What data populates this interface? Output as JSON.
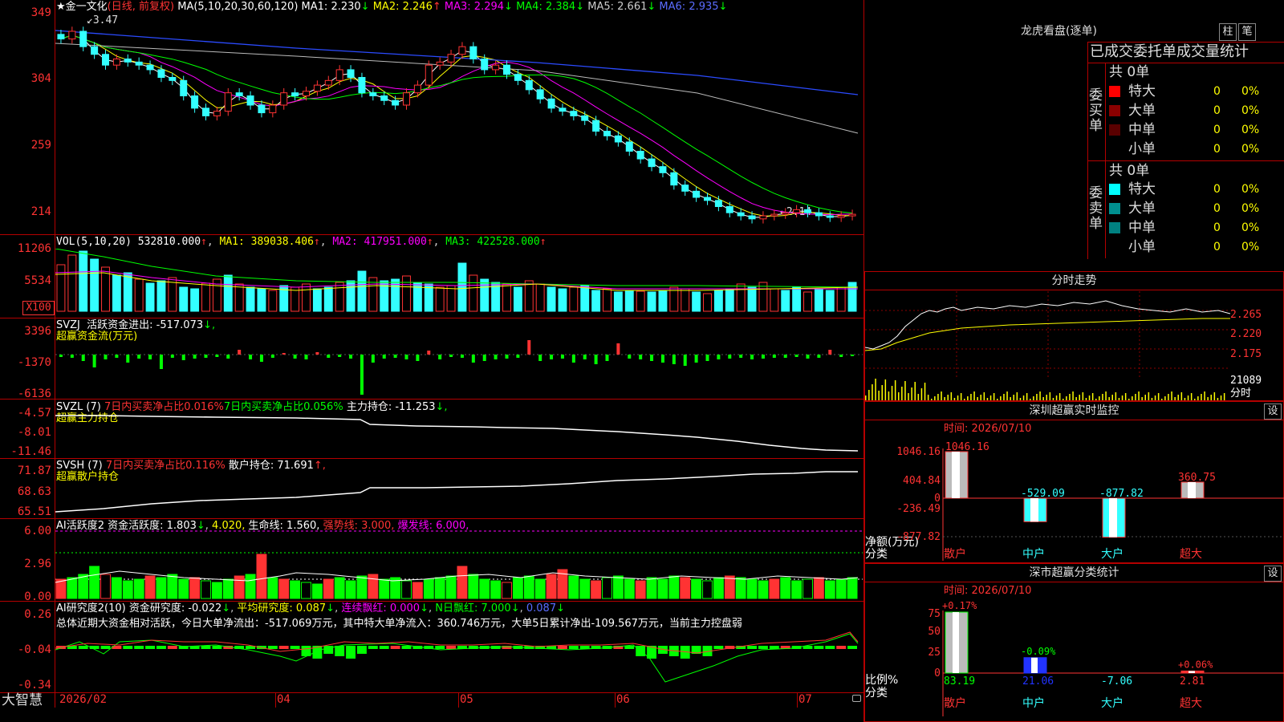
{
  "app": {
    "brand": "大智慧"
  },
  "chart_header": {
    "star": "★",
    "stock_name": "金一文化",
    "period": "(日线, 前复权)",
    "ma_title": "MA(5,10,20,30,60,120)",
    "ma": [
      {
        "label": "MA1:",
        "value": "2.230",
        "arrow": "↓",
        "color": "#ffffff"
      },
      {
        "label": "MA2:",
        "value": "2.246",
        "arrow": "↑",
        "color": "#ffff00"
      },
      {
        "label": "MA3:",
        "value": "2.294",
        "arrow": "↓",
        "color": "#ff00ff"
      },
      {
        "label": "MA4:",
        "value": "2.384",
        "arrow": "↓",
        "color": "#00ff00"
      },
      {
        "label": "MA5:",
        "value": "2.661",
        "arrow": "↓",
        "color": "#cccccc"
      },
      {
        "label": "MA6:",
        "value": "2.935",
        "arrow": "↓",
        "color": "#2b4bff"
      }
    ],
    "high_mark": "3.47",
    "low_mark": "←2.14"
  },
  "price_axis": [
    "349",
    "304",
    "259",
    "214"
  ],
  "vol_panel": {
    "title": "VOL(5,10,20)",
    "value": "532810.000",
    "ma1": "MA1: 389038.406",
    "ma2": "MA2: 417951.000",
    "ma3": "MA3: 422528.000",
    "axis": [
      "11206",
      "5534",
      "X100"
    ]
  },
  "svzj_panel": {
    "title": "SVZJ",
    "line1": "活跃资金进出: -517.073",
    "arrow": "↓,",
    "sub": "超赢资金流(万元)",
    "axis": [
      "3396",
      "-1370",
      "-6136"
    ]
  },
  "svzl_panel": {
    "title": "SVZL (7)",
    "red1": "7日内买卖净占比0.016%",
    "green1": "7日内买卖净占比0.056%",
    "main": "主力持仓: -11.253",
    "arrow": "↓,",
    "sub": "超赢主力持仓",
    "axis": [
      "-4.57",
      "-8.01",
      "-11.46"
    ]
  },
  "svsh_panel": {
    "title": "SVSH (7)",
    "red1": "7日内买卖净占比0.116%",
    "main": "散户持仓: 71.691",
    "arrow": "↑,",
    "sub": "超赢散户持仓",
    "axis": [
      "71.87",
      "68.63",
      "65.51"
    ]
  },
  "ai_active_panel": {
    "title": "AI活跃度2",
    "main": "资金活跃度: 1.803",
    "v2": "4.020,",
    "life": "生命线: 1.560,",
    "strong": "强势线: 3.000,",
    "burst": "爆发线: 6.000,",
    "axis": [
      "6.00",
      "2.96",
      "0.00"
    ]
  },
  "ai_research_panel": {
    "title": "AI研究度2(10)",
    "main": "资金研究度: -0.022",
    "avg": "平均研究度: 0.087",
    "red_cont": "连续飘红: 0.000",
    "n_red": "N日飘红: 7.000",
    "last": "0.087",
    "summary": "总体近期大资金相对活跃，今日大单净流出：-517.069万元，其中特大单净流入：360.746万元，大单5日累计净出-109.567万元，当前主力控盘弱",
    "axis": [
      "0.26",
      "-0.04",
      "-0.34"
    ]
  },
  "x_axis": [
    "2026/02",
    "04",
    "05",
    "06",
    "07"
  ],
  "right_panel": {
    "lhb_title": "龙虎看盘(逐单)",
    "btn_bar": "柱",
    "btn_pen": "笔",
    "order_stats_title": "已成交委托单成交量统计",
    "buy_side_label": "委买单",
    "sell_side_label": "委卖单",
    "buy_total": "共 0单",
    "sell_total": "共 0单",
    "buy_rows": [
      {
        "label": "特大",
        "count": "0",
        "pct": "0%",
        "color": "#ff0000"
      },
      {
        "label": "大单",
        "count": "0",
        "pct": "0%",
        "color": "#8b0000"
      },
      {
        "label": "中单",
        "count": "0",
        "pct": "0%",
        "color": "#5a0000"
      },
      {
        "label": "小单",
        "count": "0",
        "pct": "0%",
        "color": ""
      }
    ],
    "sell_rows": [
      {
        "label": "特大",
        "count": "0",
        "pct": "0%",
        "color": "#00ffff"
      },
      {
        "label": "大单",
        "count": "0",
        "pct": "0%",
        "color": "#009090"
      },
      {
        "label": "中单",
        "count": "0",
        "pct": "0%",
        "color": "#008080"
      },
      {
        "label": "小单",
        "count": "0",
        "pct": "0%",
        "color": ""
      }
    ],
    "intraday_title": "分时走势",
    "intraday_axis": [
      "2.265",
      "2.220",
      "2.175"
    ],
    "intraday_vol": "21089",
    "intraday_label": "分时",
    "sz_title": "深圳超赢实时监控",
    "sz_set": "设",
    "sz_time": "时间: 2026/07/10",
    "sz_axis": [
      "1046.16",
      "404.84",
      "0",
      "-236.49",
      "-877.82"
    ],
    "sz_unit": "净额(万元)",
    "sz_cat": "分类",
    "sz_bars": [
      {
        "name": "散户",
        "value": 1046.16,
        "label": "1046.16"
      },
      {
        "name": "中户",
        "value": -529.09,
        "label": "-529.09"
      },
      {
        "name": "大户",
        "value": -877.82,
        "label": "-877.82"
      },
      {
        "name": "超大",
        "value": 360.75,
        "label": "360.75"
      }
    ],
    "ss_title": "深市超赢分类统计",
    "ss_set": "设",
    "ss_time": "时间: 2026/07/10",
    "ss_axis": [
      "75",
      "50",
      "25",
      "0"
    ],
    "ss_unit": "比例%",
    "ss_cat": "分类",
    "ss_bars": [
      {
        "name": "散户",
        "value": 83.19,
        "top": "+0.17%",
        "bottom": "83.19"
      },
      {
        "name": "中户",
        "value": 21.06,
        "top": "-0.09%",
        "bottom": "21.06"
      },
      {
        "name": "大户",
        "value": -7.06,
        "top": "",
        "bottom": "-7.06"
      },
      {
        "name": "超大",
        "value": 2.81,
        "top": "+0.06%",
        "bottom": "2.81"
      }
    ]
  },
  "chart_data": {
    "type": "candlestick",
    "x_ticks": [
      "2026/02",
      "04",
      "05",
      "06",
      "07"
    ],
    "y_ticks": [
      349,
      304,
      259,
      214
    ],
    "ylim": [
      208,
      352
    ],
    "high": 3.47,
    "low": 2.14,
    "ma_last": {
      "MA1": 2.23,
      "MA2": 2.246,
      "MA3": 2.294,
      "MA4": 2.384,
      "MA5": 2.661,
      "MA6": 2.935
    },
    "close_series": [
      335,
      340,
      330,
      325,
      318,
      322,
      320,
      318,
      315,
      310,
      308,
      298,
      290,
      285,
      288,
      300,
      298,
      292,
      287,
      292,
      300,
      298,
      301,
      305,
      308,
      315,
      310,
      300,
      298,
      295,
      292,
      300,
      305,
      318,
      320,
      325,
      330,
      322,
      315,
      318,
      312,
      308,
      302,
      296,
      290,
      288,
      285,
      282,
      275,
      272,
      268,
      262,
      257,
      252,
      248,
      240,
      236,
      232,
      230,
      226,
      222,
      220,
      218,
      220,
      221,
      222,
      224,
      222,
      220,
      219,
      220,
      221
    ]
  }
}
